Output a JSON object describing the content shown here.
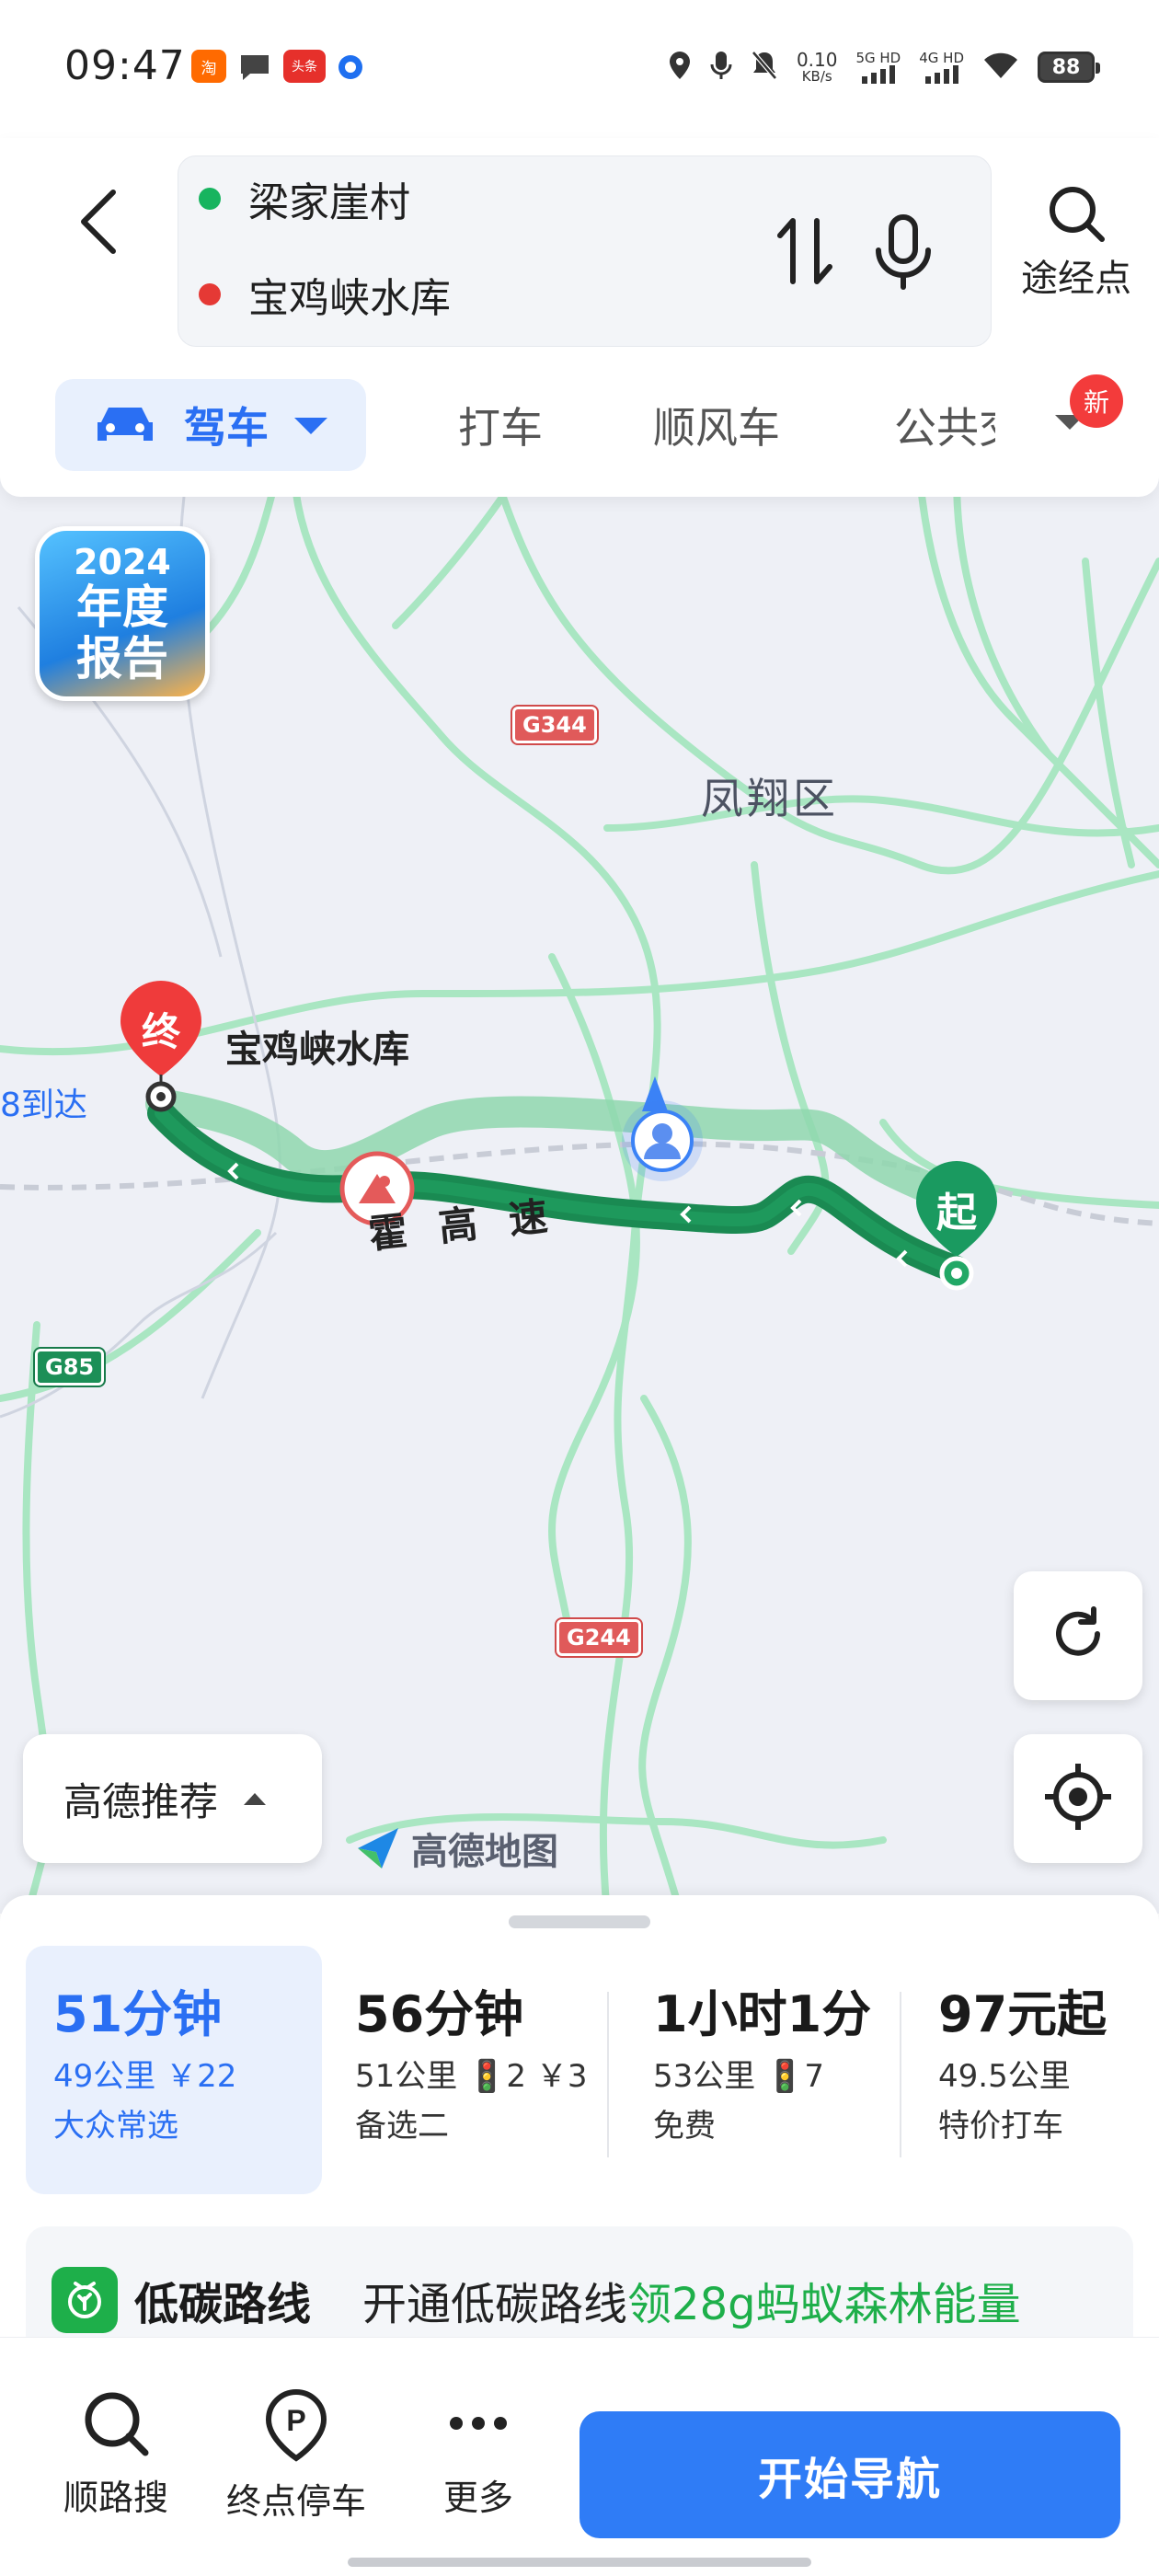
{
  "status_bar": {
    "time": "09:47",
    "net_speed_value": "0.10",
    "net_speed_unit": "KB/s",
    "net_type_1": "5G HD",
    "net_type_2": "4G HD",
    "battery": "88",
    "app_badges": [
      "淘",
      "头条"
    ]
  },
  "header": {
    "start_point": "梁家崖村",
    "end_point": "宝鸡峡水库",
    "waypoint_label": "途经点",
    "colors": {
      "start_dot": "#17b45f",
      "end_dot": "#e53935"
    }
  },
  "tabs": {
    "drive": "驾车",
    "taxi": "打车",
    "carpool": "顺风车",
    "bus": "公共交",
    "new_badge": "新"
  },
  "map": {
    "report_badge": {
      "year": "2024",
      "text": "年度报告"
    },
    "district_label": "凤翔区",
    "destination_label": "宝鸡峡水库",
    "destination_marker": "终",
    "start_marker": "起",
    "arrive_text": "8到达",
    "highway_label": "霍 高 速",
    "road_badges": [
      "G344",
      "G244",
      "G85"
    ],
    "recommend_label": "高德推荐",
    "logo_text": "高德地图",
    "icons": [
      "refresh-icon",
      "locate-icon",
      "construction-icon",
      "user-location-icon"
    ]
  },
  "routes": [
    {
      "time": "51分钟",
      "meta": "49公里 ￥22",
      "note": "大众常选",
      "selected": true
    },
    {
      "time": "56分钟",
      "meta": "51公里 🚦2 ￥3",
      "note": "备选二",
      "selected": false
    },
    {
      "time": "1小时1分",
      "meta": "53公里 🚦7",
      "note": "免费",
      "selected": false
    },
    {
      "time": "97元起",
      "meta": "49.5公里",
      "note": "特价打车",
      "selected": false
    }
  ],
  "lowcarbon": {
    "title": "低碳路线",
    "desc": "开通低碳路线",
    "promo": "领28g蚂蚁森林能量"
  },
  "bottom_bar": {
    "search_along": "顺路搜",
    "dest_parking": "终点停车",
    "more": "更多",
    "start_nav": "开始导航"
  },
  "accent_colors": {
    "primary": "#2f7cf6",
    "route_green": "#1a8a52",
    "lowcarbon_green": "#1eaf4a"
  }
}
